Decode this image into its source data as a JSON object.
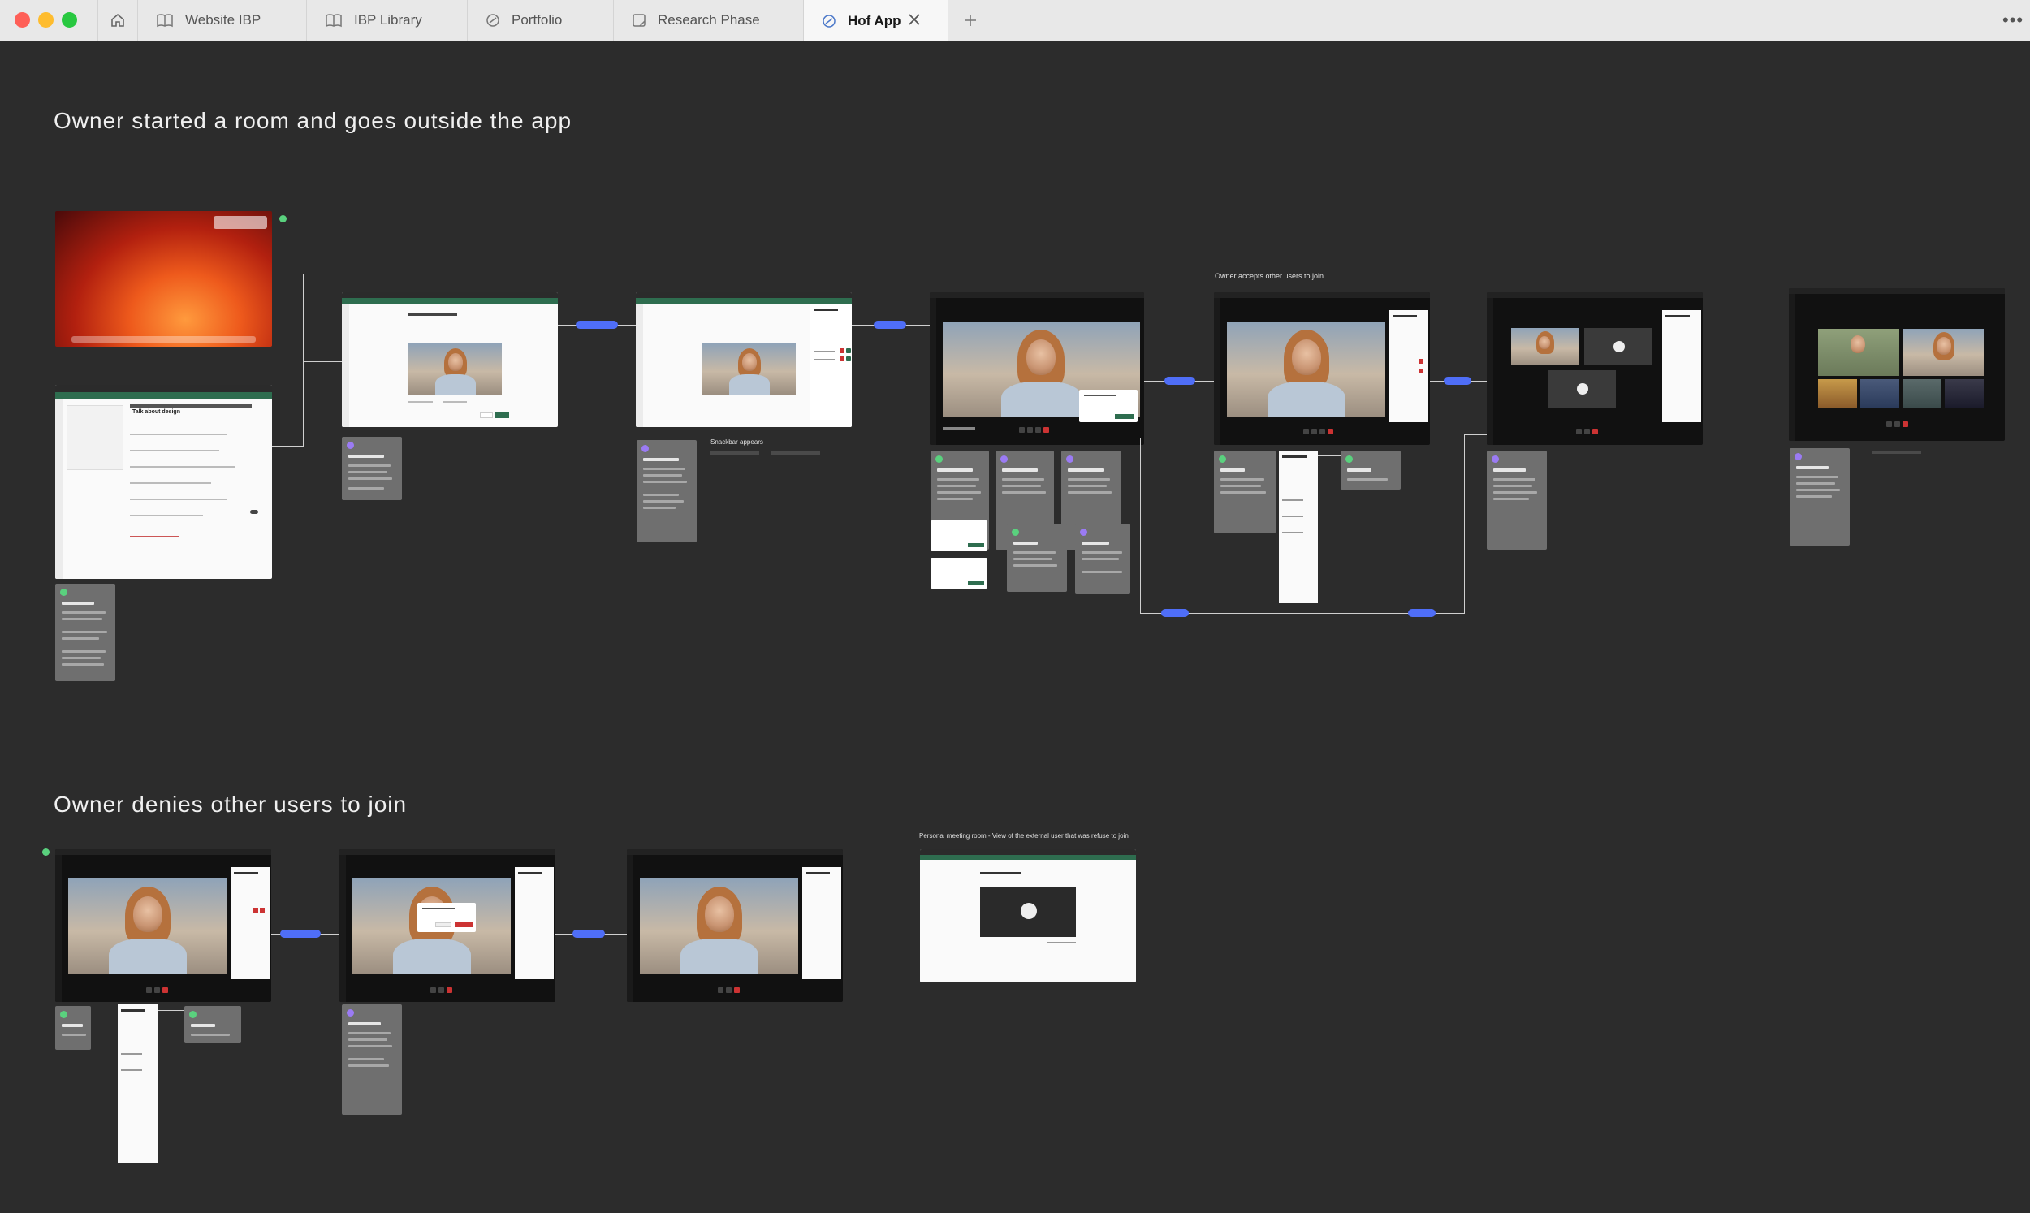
{
  "browser": {
    "tabs": [
      {
        "label": "Website IBP",
        "icon": "book-icon"
      },
      {
        "label": "IBP Library",
        "icon": "book-icon"
      },
      {
        "label": "Portfolio",
        "icon": "figma-icon"
      },
      {
        "label": "Research Phase",
        "icon": "page-icon"
      },
      {
        "label": "Hof App",
        "icon": "figma-icon",
        "active": true
      }
    ]
  },
  "canvas": {
    "section1_title": "Owner started a room and goes outside the app",
    "section2_title": "Owner denies other users to join",
    "annotation_accepts": "Owner accepts other users to join",
    "annotation_snackbar": "Snackbar appears",
    "annotation_personal_room": "Personal meeting room - View of the external user that was refuse to join",
    "frame2_heading": "Talk about design"
  },
  "colors": {
    "background": "#2c2c2c",
    "connector_pill": "#4f6ef7",
    "sticky_note": "#6f6f6f",
    "marker_green": "#5ad17e",
    "marker_purple": "#9b7bf4"
  }
}
